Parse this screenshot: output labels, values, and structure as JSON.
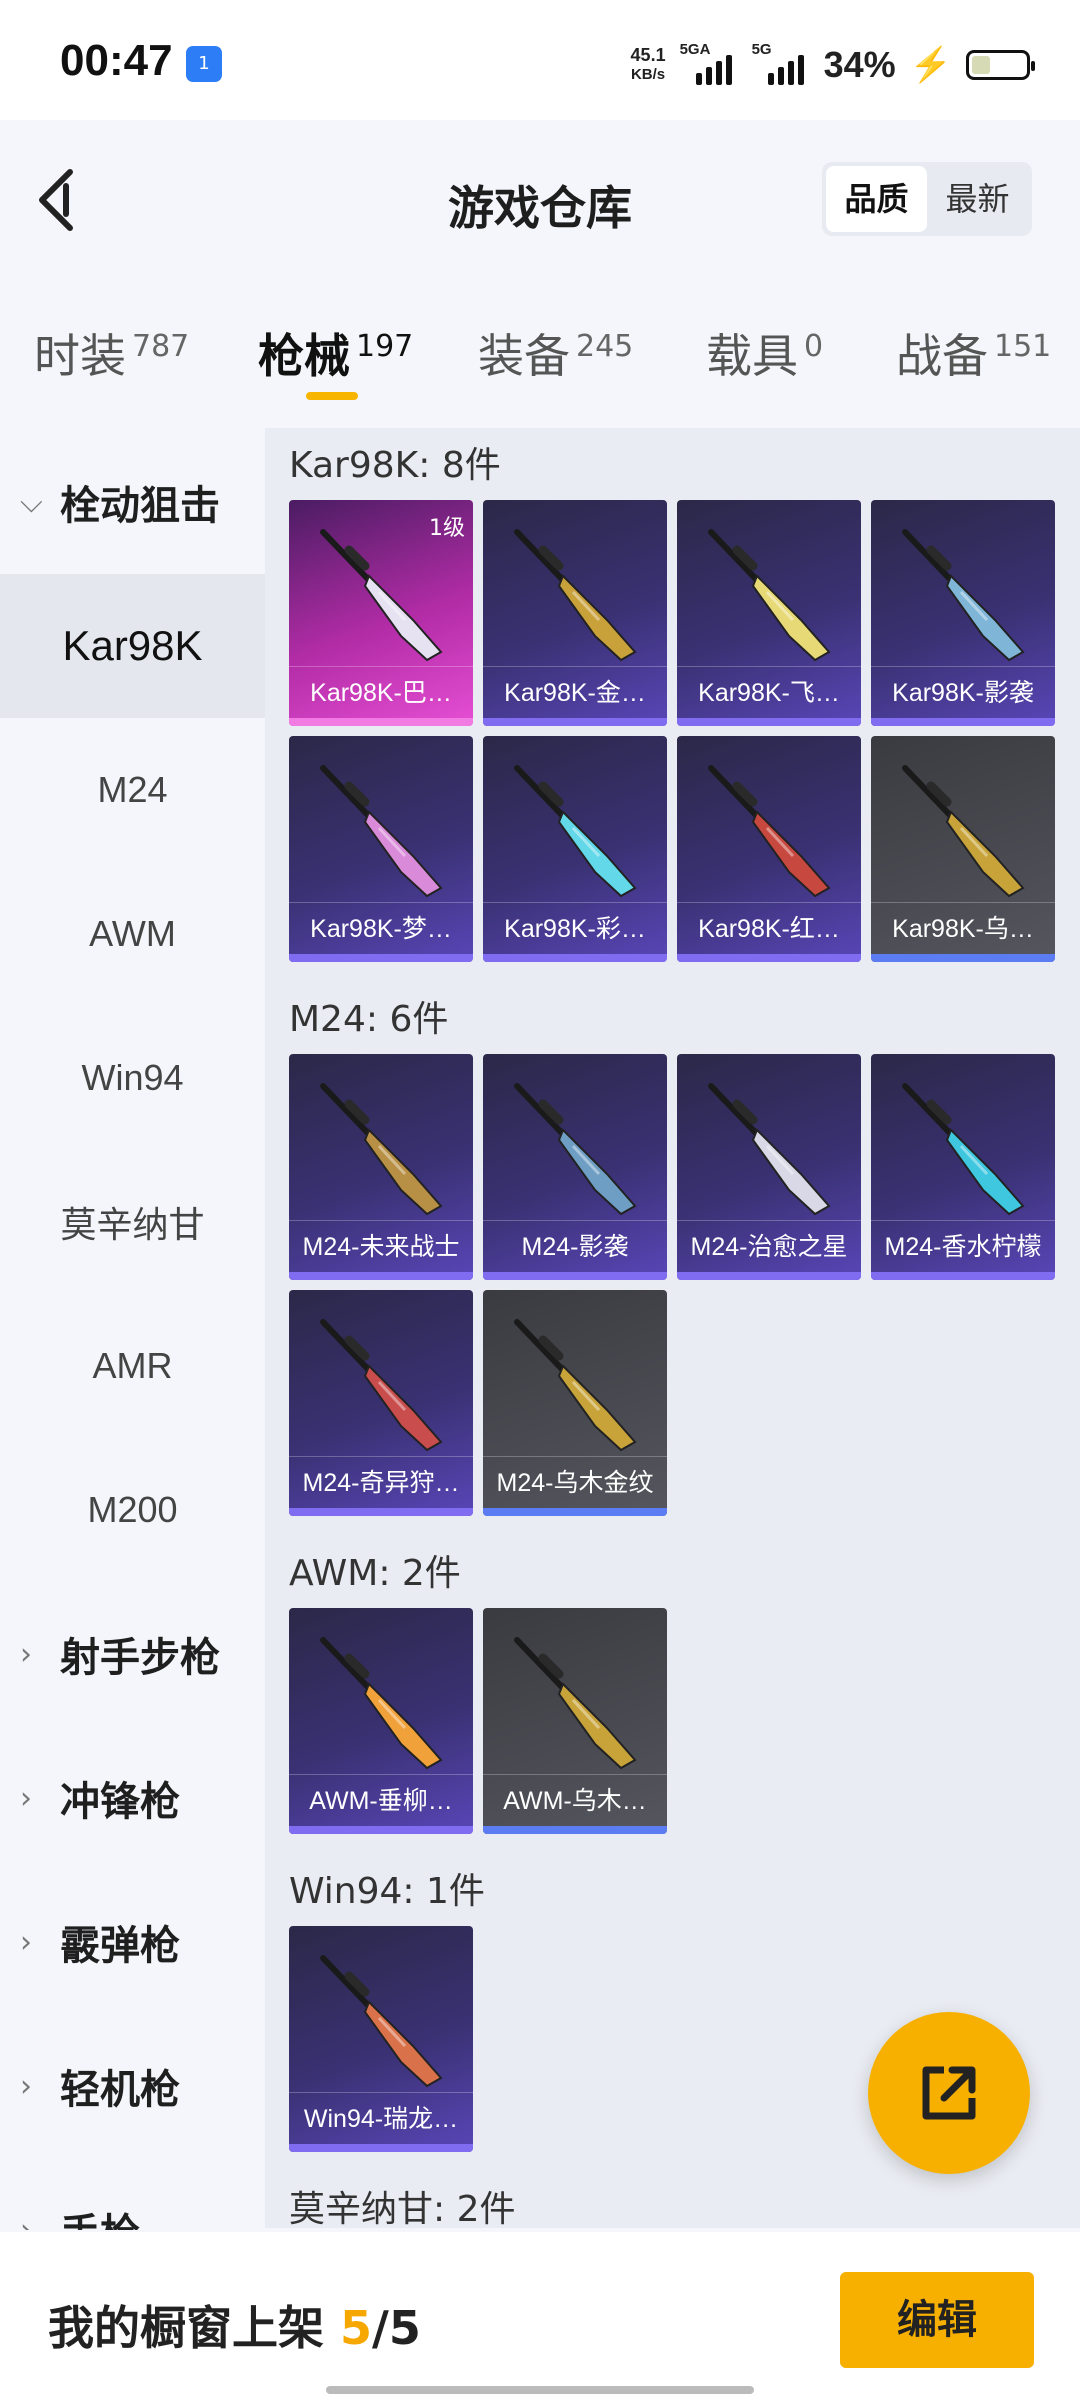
{
  "status": {
    "time": "00:47",
    "hotspot_badge": "1",
    "net_speed_value": "45.1",
    "net_speed_unit": "KB/s",
    "sim1": "5GA",
    "sim2": "5G",
    "battery": "34%",
    "battery_level": 0.34
  },
  "header": {
    "title": "游戏仓库",
    "sort_options": [
      "品质",
      "最新"
    ],
    "active_sort": "品质"
  },
  "tabs": [
    {
      "label": "时装",
      "count": "787"
    },
    {
      "label": "枪械",
      "count": "197"
    },
    {
      "label": "装备",
      "count": "245"
    },
    {
      "label": "载具",
      "count": "0"
    },
    {
      "label": "战备",
      "count": "151"
    }
  ],
  "active_tab": "枪械",
  "sidebar": [
    {
      "label": "栓动狙击",
      "group": true,
      "expanded": true
    },
    {
      "label": "Kar98K",
      "selected": true
    },
    {
      "label": "M24"
    },
    {
      "label": "AWM"
    },
    {
      "label": "Win94"
    },
    {
      "label": "莫辛纳甘"
    },
    {
      "label": "AMR"
    },
    {
      "label": "M200"
    },
    {
      "label": "射手步枪",
      "group": true
    },
    {
      "label": "冲锋枪",
      "group": true
    },
    {
      "label": "霰弹枪",
      "group": true
    },
    {
      "label": "轻机枪",
      "group": true
    },
    {
      "label": "手枪",
      "group": true
    }
  ],
  "sections": [
    {
      "title": "Kar98K: 8件",
      "items": [
        {
          "name": "Kar98K-巴…",
          "tier": "1级",
          "style": "pink",
          "gun_color": "#e7e2f2"
        },
        {
          "name": "Kar98K-金…",
          "style": "purple",
          "gun_color": "#c9a13b"
        },
        {
          "name": "Kar98K-飞…",
          "style": "purple",
          "gun_color": "#e8d977"
        },
        {
          "name": "Kar98K-影袭",
          "style": "purple",
          "gun_color": "#7fb6d8"
        },
        {
          "name": "Kar98K-梦…",
          "style": "purple",
          "gun_color": "#d98bd9"
        },
        {
          "name": "Kar98K-彩…",
          "style": "purple",
          "gun_color": "#63d8e8"
        },
        {
          "name": "Kar98K-红…",
          "style": "purple",
          "gun_color": "#c7483f"
        },
        {
          "name": "Kar98K-乌…",
          "style": "gray",
          "gun_color": "#c7a33a"
        }
      ]
    },
    {
      "title": "M24: 6件",
      "items": [
        {
          "name": "M24-未来战士",
          "style": "purple",
          "gun_color": "#b89045"
        },
        {
          "name": "M24-影袭",
          "style": "purple",
          "gun_color": "#6f9ec4"
        },
        {
          "name": "M24-治愈之星",
          "style": "purple",
          "gun_color": "#d8d8e6"
        },
        {
          "name": "M24-香水柠檬",
          "style": "purple",
          "gun_color": "#3fc7e0"
        },
        {
          "name": "M24-奇异狩…",
          "style": "purple",
          "gun_color": "#c94d4d"
        },
        {
          "name": "M24-乌木金纹",
          "style": "gray",
          "gun_color": "#c7a33a"
        }
      ]
    },
    {
      "title": "AWM: 2件",
      "items": [
        {
          "name": "AWM-垂柳…",
          "style": "purple",
          "gun_color": "#f0a13a"
        },
        {
          "name": "AWM-乌木…",
          "style": "gray",
          "gun_color": "#c7a33a"
        }
      ]
    },
    {
      "title": "Win94: 1件",
      "items": [
        {
          "name": "Win94-瑞龙…",
          "style": "purple",
          "gun_color": "#d9724a"
        }
      ]
    },
    {
      "title": "莫辛纳甘: 2件",
      "items": []
    }
  ],
  "bottom": {
    "label": "我的橱窗上架",
    "current": "5",
    "total": "/5",
    "edit_button": "编辑"
  },
  "colors": {
    "accent": "#f7b000",
    "card_purple": "#3a3173",
    "card_pink": "#b22ca6",
    "card_gray": "#4a4b52"
  }
}
